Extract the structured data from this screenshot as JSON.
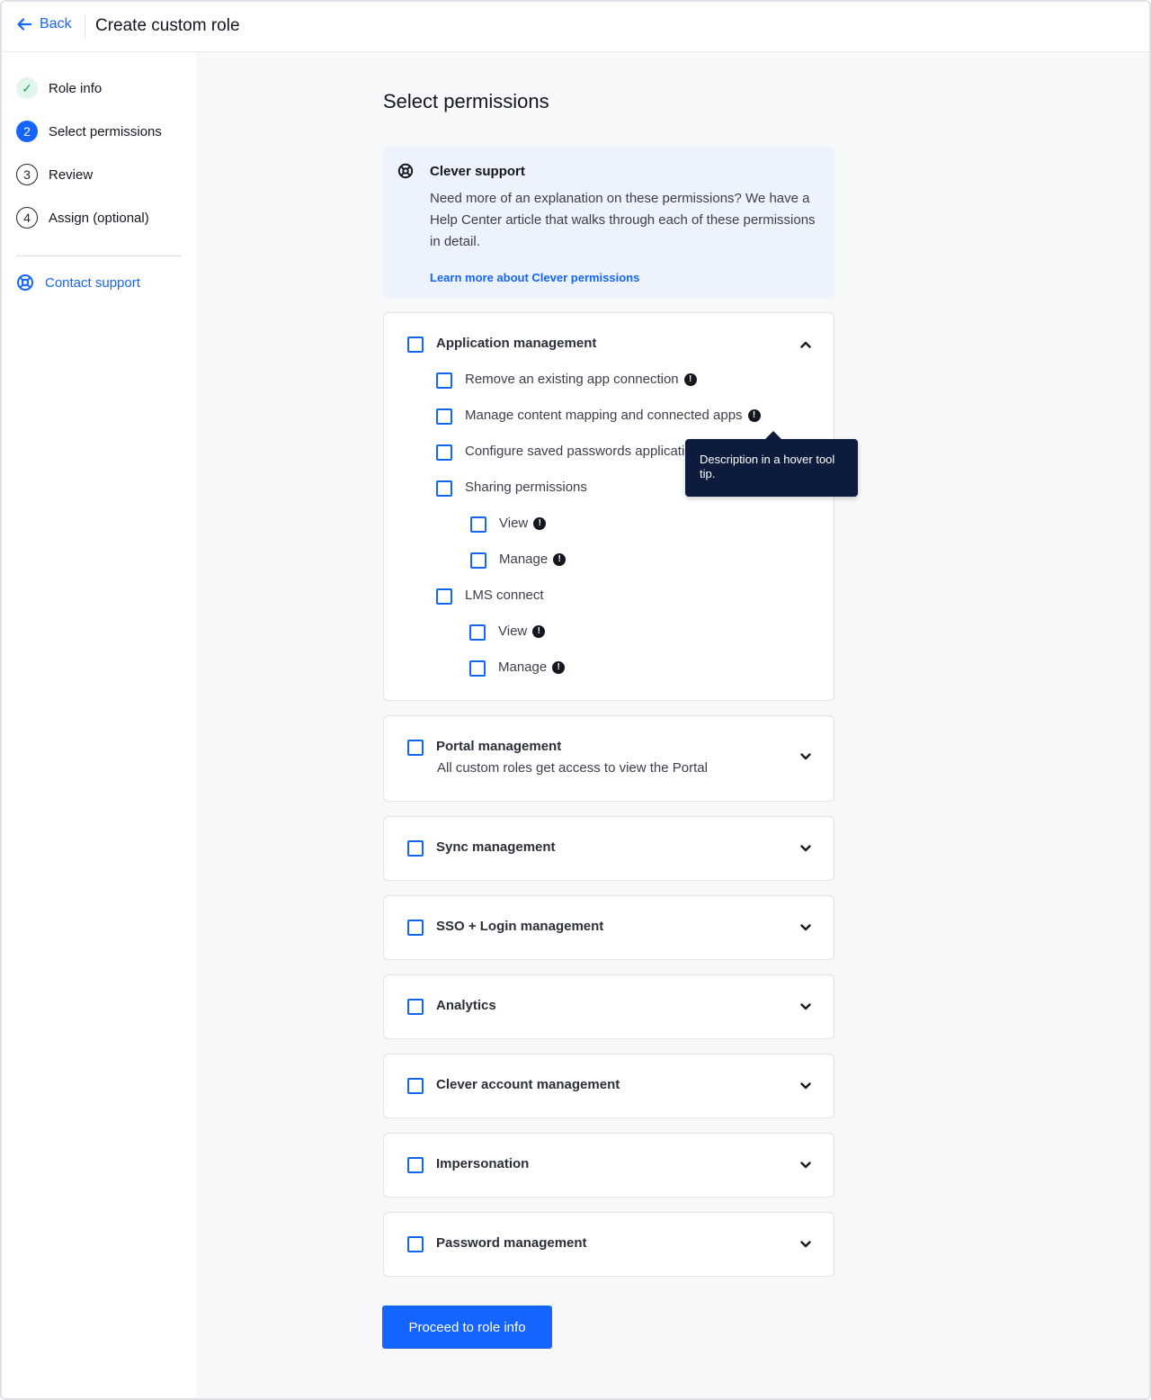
{
  "header": {
    "back_label": "Back",
    "title": "Create custom role"
  },
  "sidebar": {
    "steps": [
      {
        "marker": "✓",
        "label": "Role info",
        "state": "done"
      },
      {
        "marker": "2",
        "label": "Select permissions",
        "state": "active"
      },
      {
        "marker": "3",
        "label": "Review",
        "state": "todo"
      },
      {
        "marker": "4",
        "label": "Assign (optional)",
        "state": "todo"
      }
    ],
    "contact_label": "Contact support"
  },
  "main": {
    "heading": "Select permissions",
    "support": {
      "title": "Clever support",
      "body": "Need more of an explanation on these permissions? We have a Help Center article that walks through each of these permissions in detail.",
      "link": "Learn more about Clever permissions"
    },
    "app_management": {
      "title": "Application management",
      "items": [
        "Remove an existing app connection",
        "Manage content mapping and connected apps",
        "Configure saved passwords applications",
        "Sharing permissions",
        "View",
        "Manage",
        "LMS connect",
        "View",
        "Manage"
      ]
    },
    "portal": {
      "title": "Portal management",
      "subtitle": "All custom roles get access to view the Portal"
    },
    "sections": [
      "Sync management",
      "SSO + Login management",
      "Analytics",
      "Clever account management",
      "Impersonation",
      "Password management"
    ],
    "tooltip": "Description in a hover tool tip.",
    "proceed_label": "Proceed to role info"
  },
  "colors": {
    "accent": "#1464ff",
    "tooltip_bg": "#0d1c3d",
    "done_green": "#14a05a"
  },
  "icons": [
    "arrow-left-icon",
    "check-icon",
    "lifebuoy-icon",
    "info-icon",
    "chevron-up-icon",
    "chevron-down-icon"
  ]
}
